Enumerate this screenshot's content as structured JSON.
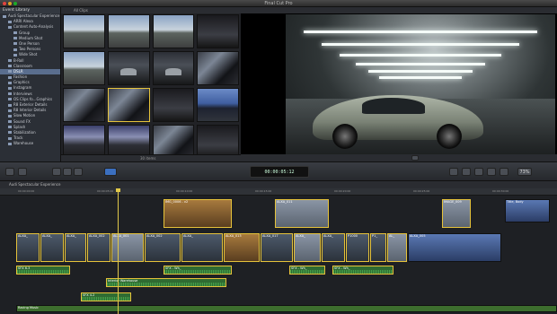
{
  "window": {
    "title": "Final Cut Pro"
  },
  "library": {
    "header": "Event Library",
    "items": [
      {
        "label": "Audi Spectacular Experience",
        "selected": false
      },
      {
        "label": "ARRI Alexa",
        "selected": false
      },
      {
        "label": "Content Auto-Analysis",
        "selected": false
      },
      {
        "label": "Group",
        "selected": false
      },
      {
        "label": "Medium Shot",
        "selected": false
      },
      {
        "label": "One Person",
        "selected": false
      },
      {
        "label": "Two Persons",
        "selected": false
      },
      {
        "label": "Wide Shot",
        "selected": false
      },
      {
        "label": "B-Roll",
        "selected": false
      },
      {
        "label": "Classroom",
        "selected": false
      },
      {
        "label": "DSLR",
        "selected": true
      },
      {
        "label": "Fashion",
        "selected": false
      },
      {
        "label": "Graphics",
        "selected": false
      },
      {
        "label": "Instagram",
        "selected": false
      },
      {
        "label": "Interviews",
        "selected": false
      },
      {
        "label": "OS Clips fo...Graphics",
        "selected": false
      },
      {
        "label": "R8 Exterior Details",
        "selected": false
      },
      {
        "label": "R8 Interior Details",
        "selected": false
      },
      {
        "label": "Slow Motion",
        "selected": false
      },
      {
        "label": "Sound FX",
        "selected": false
      },
      {
        "label": "Splash",
        "selected": false
      },
      {
        "label": "Stabilization",
        "selected": false
      },
      {
        "label": "Track",
        "selected": false
      },
      {
        "label": "Warehouse",
        "selected": false
      }
    ]
  },
  "browser": {
    "header": "All Clips",
    "footer_status": "30 items"
  },
  "toolbar": {
    "timecode": "00:00:05:12",
    "zoom": "73%"
  },
  "timeline": {
    "project_name": "Audi Spectacular Experience",
    "ruler_ticks": [
      "00:00:00:00",
      "00:00:05:00",
      "00:00:10:00",
      "00:00:15:00",
      "00:00:20:00",
      "00:00:25:00",
      "00:00:30:00"
    ],
    "connected_clips": [
      {
        "label": "IMG_0006 - v2"
      },
      {
        "label": "ALXA_011"
      },
      {
        "label": "IMAGE_009"
      },
      {
        "label": "Title, Body"
      }
    ],
    "primary_clips": [
      {
        "label": "ALXA_"
      },
      {
        "label": "ALXA_"
      },
      {
        "label": "ALXA_"
      },
      {
        "label": "ALXA_002"
      },
      {
        "label": "ALXA_001"
      },
      {
        "label": "ALXA_002"
      },
      {
        "label": "ALXA_"
      },
      {
        "label": "ALXA_013"
      },
      {
        "label": "ALXA_017"
      },
      {
        "label": "ALXA_"
      },
      {
        "label": "ALXA_"
      },
      {
        "label": "P1000"
      },
      {
        "label": "P1_"
      },
      {
        "label": "AL_"
      },
      {
        "label": "ALXA_005"
      }
    ],
    "audio_clips": [
      {
        "label": "SFX 6.3"
      },
      {
        "label": "SFX - Wh_"
      },
      {
        "label": "SFX - Wh_"
      },
      {
        "label": "SFX - Wh_"
      },
      {
        "label": "Interior Warehouse"
      },
      {
        "label": "SFX 4.2"
      }
    ],
    "music": {
      "label": "Racing Music"
    }
  }
}
